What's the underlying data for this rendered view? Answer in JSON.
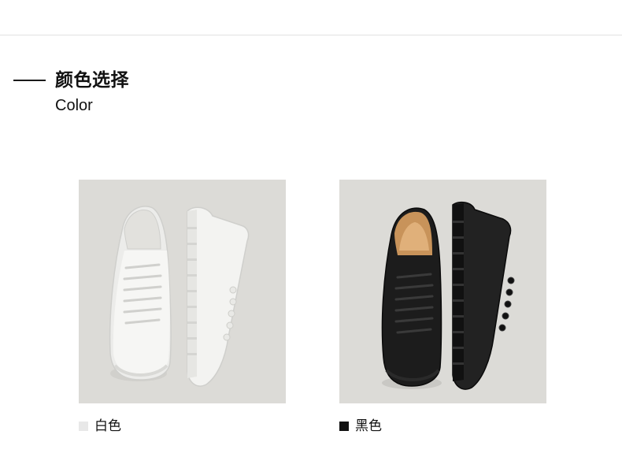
{
  "section": {
    "title_cn": "颜色选择",
    "title_en": "Color"
  },
  "options": [
    {
      "label": "白色",
      "chip_color": "#e8e8e8",
      "image": "white-sneakers-photo"
    },
    {
      "label": "黑色",
      "chip_color": "#111111",
      "image": "black-sneakers-photo"
    }
  ],
  "colors": {
    "photo_bg": "#dcdbd7",
    "divider": "#e2e2e2"
  }
}
